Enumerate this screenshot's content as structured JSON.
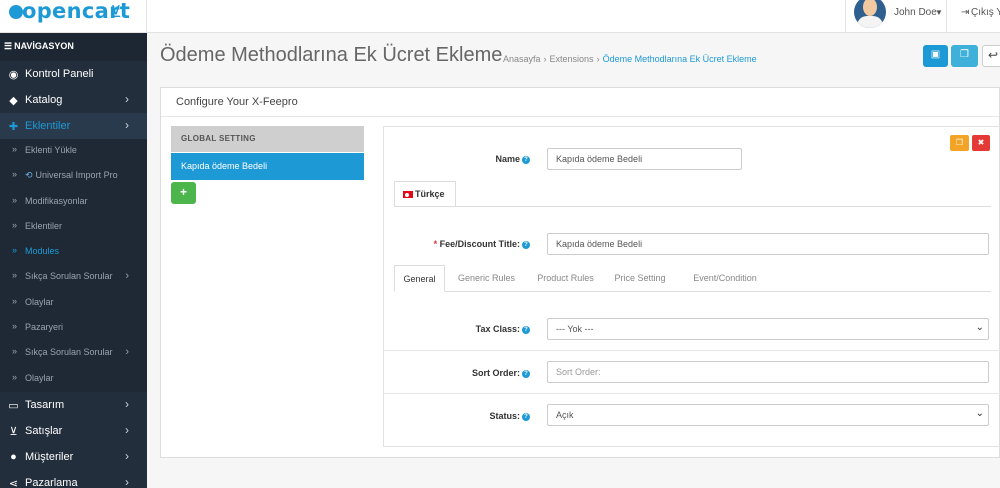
{
  "header": {
    "logo_text": "opencart",
    "user_name": "John Doe",
    "logout_label": "Çıkış Yap"
  },
  "sidebar": {
    "title": "NAVİGASYON",
    "items": [
      {
        "label": "Kontrol Paneli",
        "icon": "dashboard-icon"
      },
      {
        "label": "Katalog",
        "icon": "tag-icon"
      },
      {
        "label": "Eklentiler",
        "icon": "puzzle-icon"
      }
    ],
    "sub_items": [
      {
        "label": "Eklenti Yükle"
      },
      {
        "label": "Universal Import Pro"
      },
      {
        "label": "Modifikasyonlar"
      },
      {
        "label": "Eklentiler"
      },
      {
        "label": "Modules"
      },
      {
        "label": "Sıkça Sorulan Sorular"
      },
      {
        "label": "Olaylar"
      },
      {
        "label": "Pazaryeri"
      },
      {
        "label": "Sıkça Sorulan Sorular"
      },
      {
        "label": "Olaylar"
      }
    ],
    "bottom_items": [
      {
        "label": "Tasarım",
        "icon": "monitor-icon"
      },
      {
        "label": "Satışlar",
        "icon": "cart-icon"
      },
      {
        "label": "Müşteriler",
        "icon": "user-icon"
      },
      {
        "label": "Pazarlama",
        "icon": "share-icon"
      }
    ]
  },
  "page": {
    "title": "Ödeme Methodlarına Ek Ücret Ekleme",
    "breadcrumb": [
      "Anasayfa",
      "Extensions",
      "Ödeme Methodlarına Ek Ücret Ekleme"
    ]
  },
  "panel": {
    "heading": "Configure Your X-Feepro",
    "global_setting": "GLOBAL SETTING",
    "fee_item": "Kapıda ödeme Bedeli",
    "add_icon": "plus-icon"
  },
  "form": {
    "name_label": "Name",
    "name_value": "Kapıda ödeme Bedeli",
    "language_tab": "Türkçe",
    "fee_title_label": "Fee/Discount Title:",
    "fee_title_value": "Kapıda ödeme Bedeli",
    "tabs": [
      "General",
      "Generic Rules",
      "Product Rules",
      "Price Setting",
      "Event/Condition"
    ],
    "tax_class_label": "Tax Class:",
    "tax_class_value": "--- Yok ---",
    "sort_order_label": "Sort Order:",
    "sort_order_placeholder": "Sort Order:",
    "status_label": "Status:",
    "status_value": "Açık"
  },
  "colors": {
    "accent": "#1d9ad6",
    "sidebar_bg": "#232e3c",
    "success": "#4cb64c",
    "warning": "#f3a325",
    "danger": "#e53935"
  }
}
